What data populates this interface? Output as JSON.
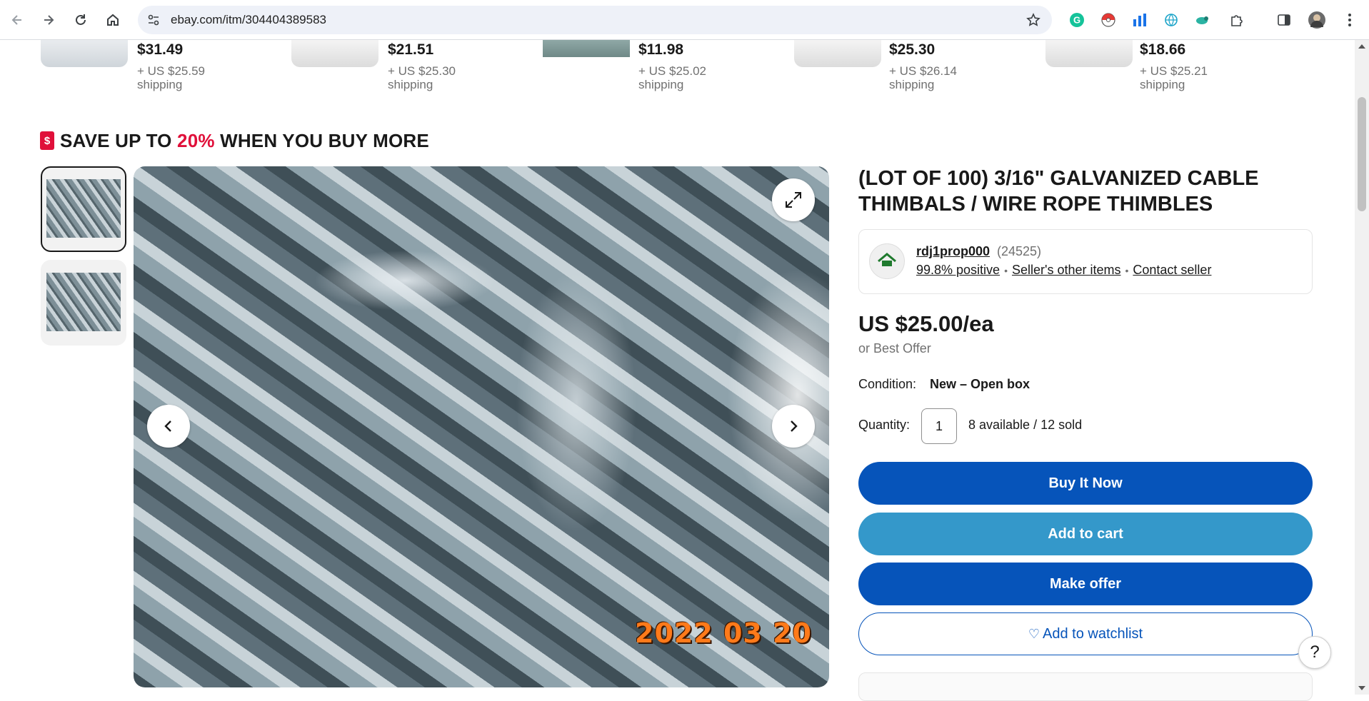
{
  "browser": {
    "url": "ebay.com/itm/304404389583",
    "back_icon": "arrow-left-icon",
    "forward_icon": "arrow-right-icon",
    "reload_icon": "reload-icon",
    "home_icon": "home-icon"
  },
  "similar_items": [
    {
      "price": "$31.49",
      "shipping_line1": "+ US $25.59",
      "shipping_line2": "shipping"
    },
    {
      "price": "$21.51",
      "shipping_line1": "+ US $25.30",
      "shipping_line2": "shipping"
    },
    {
      "price": "$11.98",
      "shipping_line1": "+ US $25.02",
      "shipping_line2": "shipping"
    },
    {
      "price": "$25.30",
      "shipping_line1": "+ US $26.14",
      "shipping_line2": "shipping"
    },
    {
      "price": "$18.66",
      "shipping_line1": "+ US $25.21",
      "shipping_line2": "shipping"
    }
  ],
  "save_banner": {
    "prefix": "SAVE UP TO ",
    "percent": "20%",
    "suffix": " WHEN YOU BUY MORE",
    "accent_color": "#e0103a"
  },
  "gallery": {
    "date_stamp": "2022 03 20"
  },
  "listing": {
    "title": "(LOT OF 100) 3/16\" GALVANIZED CABLE THIMBALS / WIRE ROPE THIMBLES",
    "seller": {
      "name": "rdj1prop000",
      "feedback_count": "(24525)",
      "positive": "99.8% positive",
      "other_items": "Seller's other items",
      "contact": "Contact seller"
    },
    "price": "US $25.00/ea",
    "best_offer": "or Best Offer",
    "condition_label": "Condition:",
    "condition_value": "New – Open box",
    "quantity_label": "Quantity:",
    "quantity_value": "1",
    "availability": "8 available / 12 sold",
    "buttons": {
      "buy": "Buy It Now",
      "cart": "Add to cart",
      "offer": "Make offer",
      "watch": "Add to watchlist"
    },
    "primary_color": "#0654ba",
    "cart_color": "#3498ca"
  },
  "help_label": "?"
}
